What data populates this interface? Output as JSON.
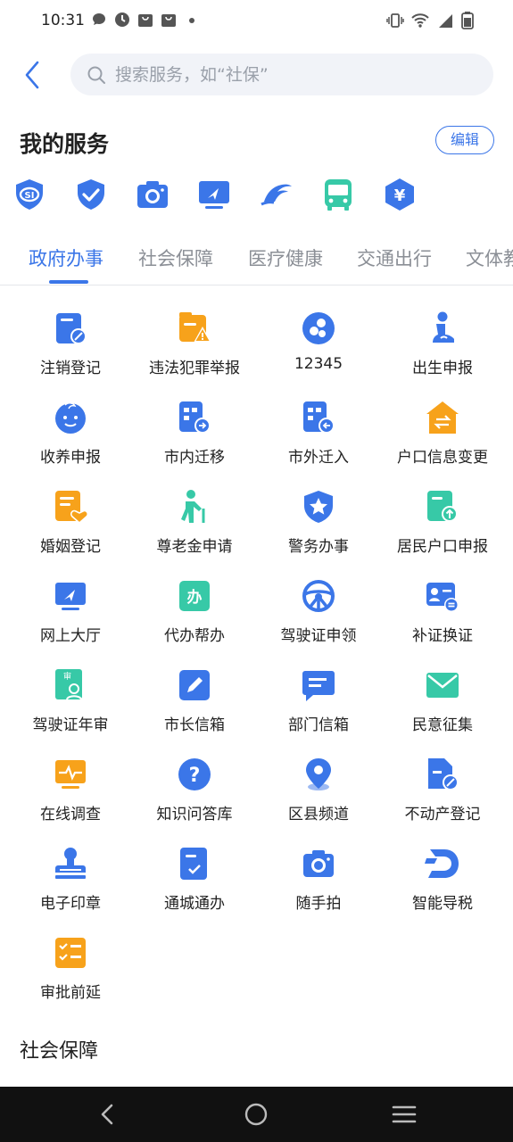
{
  "status": {
    "time": "10:31",
    "icons": [
      "message-icon",
      "clock-icon",
      "bag-icon",
      "bag-icon",
      "dot-icon",
      "vibrate-icon",
      "wifi-icon",
      "signal-icon",
      "battery-icon"
    ]
  },
  "search": {
    "placeholder": "搜索服务，如“社保”"
  },
  "my_services": {
    "title": "我的服务",
    "edit_label": "编辑",
    "favorites": [
      "social-security-icon",
      "shield-check-icon",
      "camera-icon",
      "online-hall-icon",
      "transport-logo-icon",
      "bus-icon",
      "yuan-house-icon"
    ]
  },
  "tabs": [
    {
      "label": "政府办事",
      "active": true
    },
    {
      "label": "社会保障",
      "active": false
    },
    {
      "label": "医疗健康",
      "active": false
    },
    {
      "label": "交通出行",
      "active": false
    },
    {
      "label": "文体教",
      "active": false
    }
  ],
  "services": [
    {
      "label": "注销登记",
      "icon": "doc-cancel-icon"
    },
    {
      "label": "违法犯罪举报",
      "icon": "report-warning-icon"
    },
    {
      "label": "12345",
      "icon": "hotline-icon"
    },
    {
      "label": "出生申报",
      "icon": "birth-icon"
    },
    {
      "label": "收养申报",
      "icon": "baby-face-icon"
    },
    {
      "label": "市内迁移",
      "icon": "move-in-city-icon"
    },
    {
      "label": "市外迁入",
      "icon": "move-from-outside-icon"
    },
    {
      "label": "户口信息变更",
      "icon": "household-change-icon"
    },
    {
      "label": "婚姻登记",
      "icon": "marriage-icon"
    },
    {
      "label": "尊老金申请",
      "icon": "elderly-icon"
    },
    {
      "label": "警务办事",
      "icon": "police-star-icon"
    },
    {
      "label": "居民户口申报",
      "icon": "resident-upload-icon"
    },
    {
      "label": "网上大厅",
      "icon": "online-hall-icon"
    },
    {
      "label": "代办帮办",
      "icon": "agent-icon"
    },
    {
      "label": "驾驶证申领",
      "icon": "steering-wheel-icon"
    },
    {
      "label": "补证换证",
      "icon": "id-card-icon"
    },
    {
      "label": "驾驶证年审",
      "icon": "license-review-icon"
    },
    {
      "label": "市长信箱",
      "icon": "mayor-mail-icon"
    },
    {
      "label": "部门信箱",
      "icon": "dept-mail-icon"
    },
    {
      "label": "民意征集",
      "icon": "envelope-icon"
    },
    {
      "label": "在线调查",
      "icon": "survey-monitor-icon"
    },
    {
      "label": "知识问答库",
      "icon": "question-icon"
    },
    {
      "label": "区县频道",
      "icon": "location-pin-icon"
    },
    {
      "label": "不动产登记",
      "icon": "property-doc-icon"
    },
    {
      "label": "电子印章",
      "icon": "stamp-icon"
    },
    {
      "label": "通城通办",
      "icon": "checklist-icon"
    },
    {
      "label": "随手拍",
      "icon": "camera-icon"
    },
    {
      "label": "智能导税",
      "icon": "tax-guide-icon"
    },
    {
      "label": "审批前延",
      "icon": "approval-list-icon"
    }
  ],
  "next_section": "社会保障",
  "colors": {
    "accent": "#3b76e8",
    "orange": "#f7a21b",
    "teal": "#37c9a7"
  }
}
